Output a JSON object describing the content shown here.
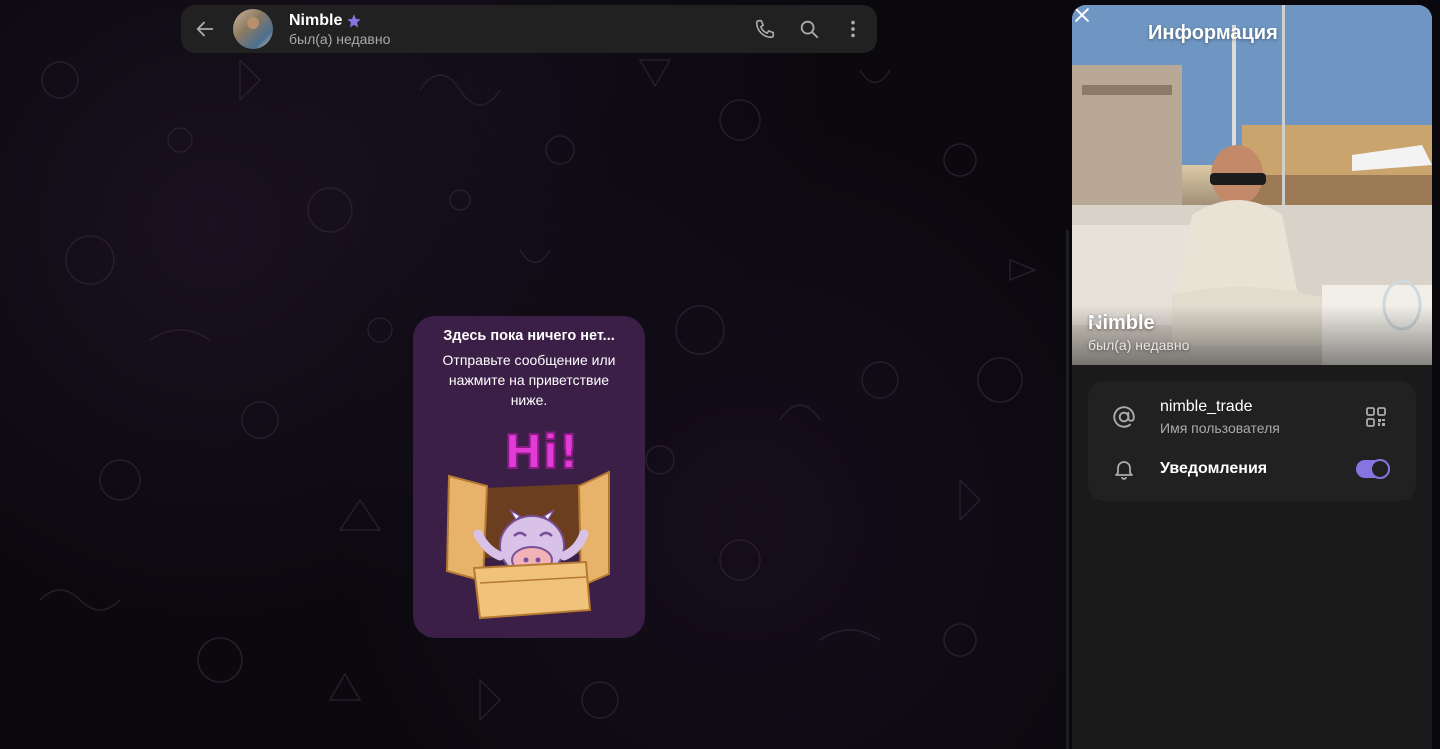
{
  "chat": {
    "title": "Nimble",
    "status": "был(а) недавно"
  },
  "empty_state": {
    "title": "Здесь пока ничего нет...",
    "description": "Отправьте сообщение или нажмите на приветствие ниже.",
    "sticker_text": "Hi!"
  },
  "info_panel": {
    "title": "Информация",
    "profile_name": "Nimble",
    "profile_status": "был(а) недавно",
    "username": "nimble_trade",
    "username_label": "Имя пользователя",
    "notifications_label": "Уведомления",
    "notifications_enabled": true
  },
  "colors": {
    "accent": "#8774e1",
    "panel_bg": "#212121",
    "empty_card_bg": "#3b1f47",
    "sticker_pink": "#e23bd6"
  },
  "icons": {
    "back": "arrow-left-icon",
    "premium": "star-icon",
    "call": "phone-icon",
    "search": "search-icon",
    "more": "more-vertical-icon",
    "close": "close-icon",
    "username": "at-sign-icon",
    "qr": "qr-code-icon",
    "notifications": "bell-icon"
  }
}
